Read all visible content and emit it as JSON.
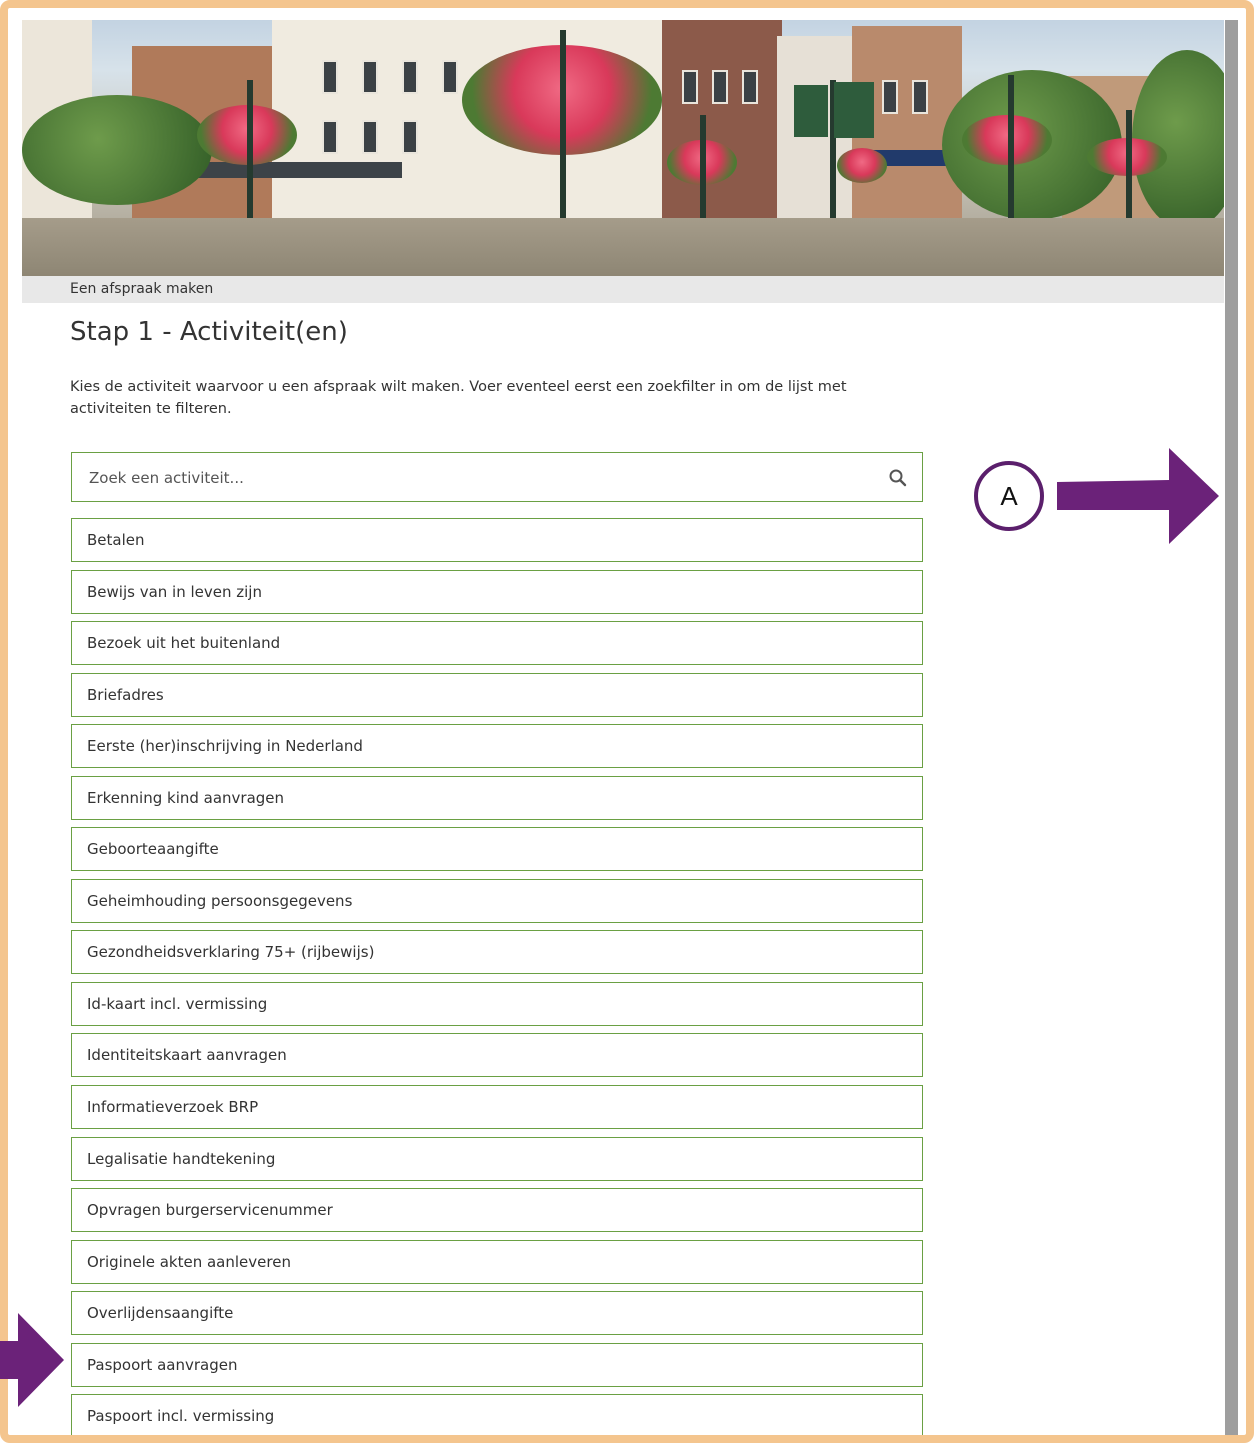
{
  "breadcrumb": "Een afspraak maken",
  "page_title": "Stap 1 - Activiteit(en)",
  "intro": "Kies de activiteit waarvoor u een afspraak wilt maken. Voer eventeel eerst een zoekfilter in om de lijst met activiteiten te filteren.",
  "search": {
    "placeholder": "Zoek een activiteit...",
    "value": ""
  },
  "activities": [
    "Betalen",
    "Bewijs van in leven zijn",
    "Bezoek uit het buitenland",
    "Briefadres",
    "Eerste (her)inschrijving in Nederland",
    "Erkenning kind aanvragen",
    "Geboorteaangifte",
    "Geheimhouding persoonsgegevens",
    "Gezondheidsverklaring 75+ (rijbewijs)",
    "Id-kaart incl. vermissing",
    "Identiteitskaart aanvragen",
    "Informatieverzoek BRP",
    "Legalisatie handtekening",
    "Opvragen burgerservicenummer",
    "Originele akten aanleveren",
    "Overlijdensaangifte",
    "Paspoort aanvragen",
    "Paspoort incl. vermissing"
  ],
  "annotation": {
    "label": "A"
  },
  "colors": {
    "frame": "#f4c58e",
    "item_border": "#6aa043",
    "annotation": "#5b1f6c",
    "breadcrumb_bar": "#e8e8e8",
    "scrollbar": "#9e9e9e"
  },
  "icons": [
    "search-icon",
    "arrow-right-icon",
    "arrow-right-edge-icon"
  ]
}
